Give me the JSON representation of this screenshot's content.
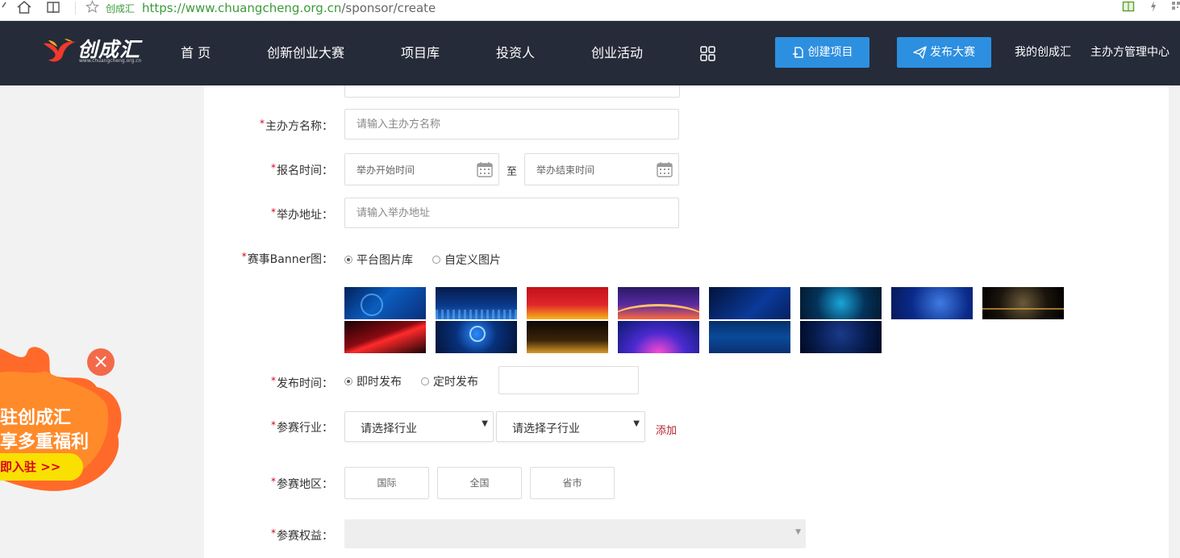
{
  "browser": {
    "site_name": "创成汇",
    "url_scheme_host": "https://www.chuangcheng.org.cn",
    "url_path": "/sponsor/create",
    "icons": [
      "home-icon",
      "reader-icon",
      "star-icon",
      "book-icon",
      "lightning-icon",
      "qr-icon"
    ]
  },
  "header": {
    "logo_text": "创成汇",
    "logo_sub": "www.chuangcheng.org.cn",
    "nav": [
      "首 页",
      "创新创业大赛",
      "项目库",
      "投资人",
      "创业活动"
    ],
    "create_project": "创建项目",
    "publish_contest": "发布大赛",
    "my_account": "我的创成汇",
    "sponsor_center": "主办方管理中心",
    "colors": {
      "bar": "#262b39",
      "button": "#2d8fe0"
    }
  },
  "form": {
    "required_mark": "*",
    "organizer": {
      "label": "主办方名称：",
      "placeholder": "请输入主办方名称"
    },
    "signup_time": {
      "label": "报名时间：",
      "start_placeholder": "举办开始时间",
      "to": "至",
      "end_placeholder": "举办结束时间"
    },
    "address": {
      "label": "举办地址：",
      "placeholder": "请输入举办地址"
    },
    "banner": {
      "label": "赛事Banner图：",
      "options": [
        "平台图片库",
        "自定义图片"
      ],
      "selected": "平台图片库",
      "thumbnail_count": 14
    },
    "publish_time": {
      "label": "发布时间：",
      "options": [
        "即时发布",
        "定时发布"
      ],
      "selected": "即时发布"
    },
    "industry": {
      "label": "参赛行业：",
      "industry_select": "请选择行业",
      "sub_select": "请选择子行业",
      "add": "添加"
    },
    "region": {
      "label": "参赛地区：",
      "options": [
        "国际",
        "全国",
        "省市"
      ]
    },
    "rights": {
      "label": "参赛权益："
    }
  },
  "promo": {
    "line1": "驻创成汇",
    "line2": "享多重福利",
    "button": "即入驻 >>",
    "close": "×"
  }
}
